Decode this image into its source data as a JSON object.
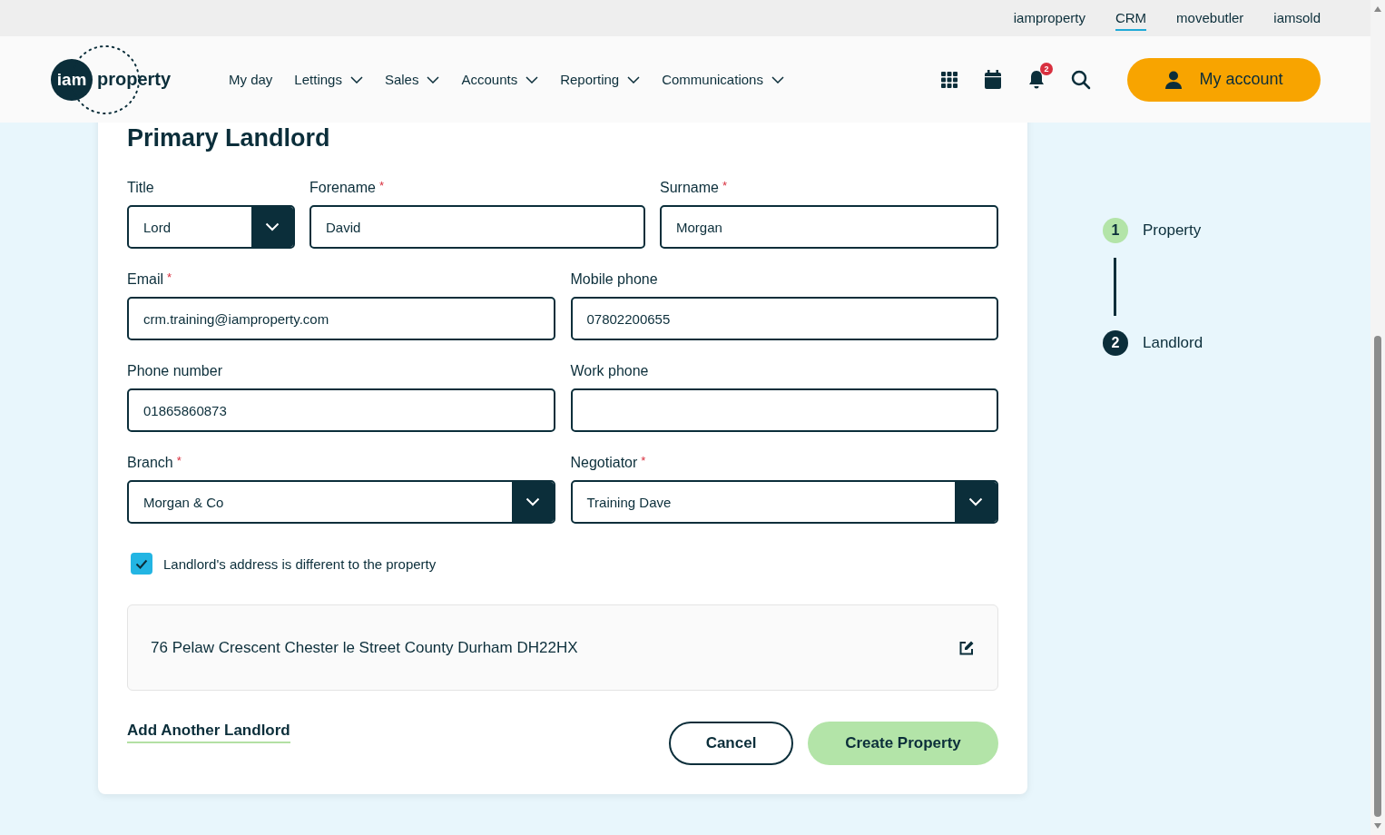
{
  "top_links": [
    {
      "label": "iamproperty",
      "selected": false
    },
    {
      "label": "CRM",
      "selected": true
    },
    {
      "label": "movebutler",
      "selected": false
    },
    {
      "label": "iamsold",
      "selected": false
    }
  ],
  "logo": {
    "badge": "iam",
    "word": "property"
  },
  "nav": [
    {
      "label": "My day",
      "dropdown": false
    },
    {
      "label": "Lettings",
      "dropdown": true
    },
    {
      "label": "Sales",
      "dropdown": true
    },
    {
      "label": "Accounts",
      "dropdown": true
    },
    {
      "label": "Reporting",
      "dropdown": true
    },
    {
      "label": "Communications",
      "dropdown": true
    }
  ],
  "notifications": {
    "count": "2"
  },
  "account_button": "My account",
  "form": {
    "heading": "Primary Landlord",
    "rows": [
      [
        {
          "label": "Title",
          "kind": "select",
          "value": "Lord"
        },
        {
          "label": "Forename",
          "kind": "text",
          "value": "David",
          "required_mark": "*"
        },
        {
          "label": "Surname",
          "kind": "text",
          "value": "Morgan",
          "required_mark": "*"
        }
      ],
      [
        {
          "label": "Email",
          "kind": "text",
          "value": "crm.training@iamproperty.com",
          "required_mark": "*"
        },
        {
          "label": "Mobile phone",
          "kind": "text",
          "value": "07802200655"
        }
      ],
      [
        {
          "label": "Phone number",
          "kind": "text",
          "value": "01865860873"
        },
        {
          "label": "Work phone",
          "kind": "text"
        }
      ],
      [
        {
          "label": "Branch",
          "kind": "select",
          "value": "Morgan & Co",
          "required_mark": "*"
        },
        {
          "label": "Negotiator",
          "kind": "select",
          "value": "Training Dave",
          "required_mark": "*"
        }
      ]
    ],
    "checkbox": {
      "label": "Landlord's address is different to the property",
      "checked": true
    },
    "address": "76 Pelaw Crescent Chester le Street County Durham DH22HX",
    "add_link": "Add Another Landlord",
    "buttons": [
      {
        "label": "Cancel",
        "kind": "outline"
      },
      {
        "label": "Create Property",
        "kind": "primary"
      }
    ]
  },
  "steps": [
    {
      "number": "1",
      "label": "Property",
      "selected": false
    },
    {
      "number": "2",
      "label": "Landlord",
      "selected": true
    }
  ]
}
